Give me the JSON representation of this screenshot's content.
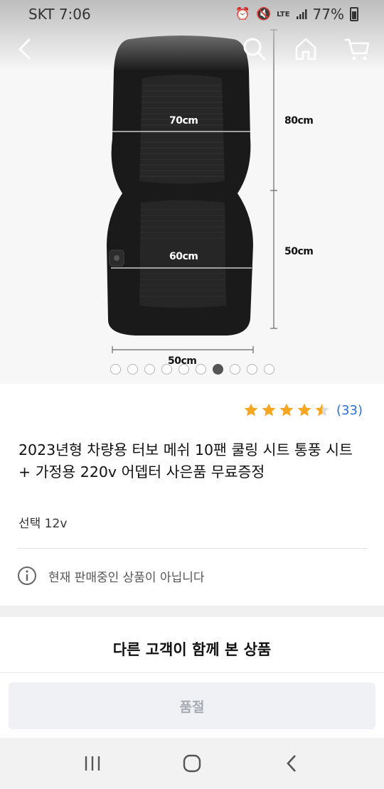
{
  "status_bar": {
    "carrier_time": "SKT 7:06",
    "network": "LTE",
    "battery": "77%"
  },
  "nav": {
    "back_icon": "back-icon",
    "search_icon": "search-icon",
    "home_icon": "home-icon",
    "cart_icon": "cart-icon"
  },
  "product_image": {
    "dim_width_top": "70cm",
    "dim_width_bottom": "60cm",
    "dim_height_top": "80cm",
    "dim_height_bottom": "50cm",
    "dim_base": "50cm",
    "carousel_count": 10,
    "carousel_active_index": 6
  },
  "rating": {
    "stars": 4.5,
    "count": "(33)",
    "color": "#f5a623"
  },
  "product": {
    "title": "2023년형 차량용 터보 메쉬 10팬 쿨링 시트 통풍 시트 + 가정용 220v 어뎁터 사은품 무료증정",
    "option": "선택 12v",
    "notice": "현재 판매중인 상품이 아닙니다"
  },
  "section": {
    "related_title": "다른 고객이 함께 본 상품"
  },
  "cta": {
    "soldout_label": "품절"
  }
}
